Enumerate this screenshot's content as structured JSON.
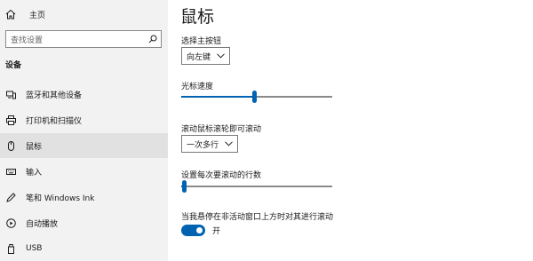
{
  "sidebar": {
    "home_label": "主页",
    "search_placeholder": "查找设置",
    "section_title": "设备",
    "items": [
      {
        "label": "蓝牙和其他设备",
        "icon": "bluetooth-devices-icon"
      },
      {
        "label": "打印机和扫描仪",
        "icon": "printer-icon"
      },
      {
        "label": "鼠标",
        "icon": "mouse-icon",
        "selected": true
      },
      {
        "label": "输入",
        "icon": "keyboard-icon"
      },
      {
        "label": "笔和 Windows Ink",
        "icon": "pen-icon"
      },
      {
        "label": "自动播放",
        "icon": "autoplay-icon"
      },
      {
        "label": "USB",
        "icon": "usb-icon"
      }
    ]
  },
  "main": {
    "title": "鼠标",
    "primary_button": {
      "label": "选择主按钮",
      "value": "向左键"
    },
    "cursor_speed": {
      "label": "光标速度",
      "level": 0.48
    },
    "wheel_scroll": {
      "label": "滚动鼠标滚轮即可滚动",
      "value": "一次多行"
    },
    "lines_per_scroll": {
      "label": "设置每次要滚动的行数",
      "level": 0.02
    },
    "inactive_scroll": {
      "label": "当我悬停在非活动窗口上方时对其进行滚动",
      "state_label": "开",
      "on": true
    }
  },
  "colors": {
    "accent": "#0063b1",
    "sidebar_bg": "#f2f2f2",
    "selected_bg": "#e1e1e1"
  }
}
